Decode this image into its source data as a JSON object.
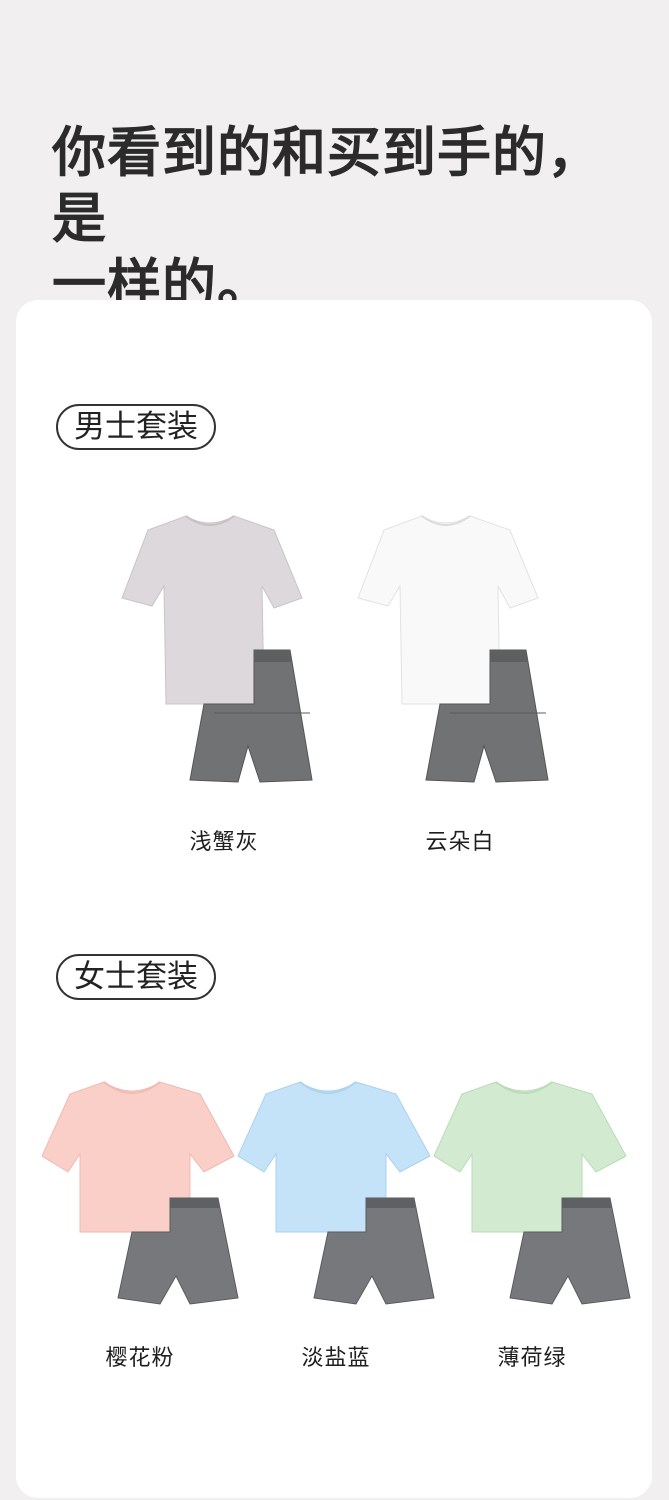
{
  "headline": {
    "line1": "你看到的和买到手的，是",
    "line2": "一样的。"
  },
  "sections": {
    "men": {
      "title": "男士套装",
      "items": [
        {
          "label": "浅蟹灰",
          "top_color": "#dcd8dc",
          "short_color": "#717273"
        },
        {
          "label": "云朵白",
          "top_color": "#f9f9f9",
          "short_color": "#717273"
        }
      ]
    },
    "women": {
      "title": "女士套装",
      "items": [
        {
          "label": "樱花粉",
          "top_color": "#f9cfc7",
          "short_color": "#76787b"
        },
        {
          "label": "淡盐蓝",
          "top_color": "#c4e2f8",
          "short_color": "#76787b"
        },
        {
          "label": "薄荷绿",
          "top_color": "#d2ebd0",
          "short_color": "#76787b"
        }
      ]
    }
  }
}
